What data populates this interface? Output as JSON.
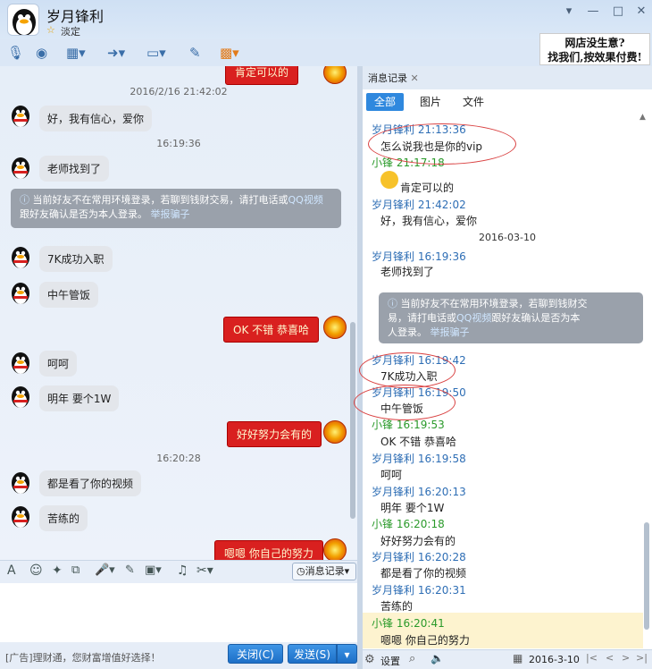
{
  "header": {
    "name": "岁月锋利",
    "status": "淡定"
  },
  "ad": {
    "line1": "网店没生意?",
    "line2": "找我们,按效果付费!"
  },
  "chat": {
    "items": {
      "red_top": "肯定可以的",
      "ts1": "2016/2/16 21:42:02",
      "m1": "好，我有信心，爱你",
      "ts2": "16:19:36",
      "m2": "老师找到了",
      "notice_a": "当前好友不在常用环境登录，若聊到钱财交易，请打电话或",
      "notice_link1": "QQ视频",
      "notice_b": "跟好友确认是否为本人登录。",
      "notice_link2": "举报骗子",
      "m3": "7K成功入职",
      "m4": "中午管饭",
      "r1": "OK 不错 恭喜哈",
      "m5": "呵呵",
      "m6": "明年 要个1W",
      "r2": "好好努力会有的",
      "ts3": "16:20:28",
      "m7": "都是看了你的视频",
      "m8": "苦练的",
      "r3": "嗯嗯 你自己的努力"
    }
  },
  "input": {
    "history_label": "消息记录"
  },
  "bottom": {
    "ad_text": "[广告]理财通，您财富增值好选择！",
    "close": "关闭(C)",
    "send": "发送(S)"
  },
  "history": {
    "tab": "消息记录",
    "filters": [
      "全部",
      "图片",
      "文件"
    ],
    "entries": [
      {
        "n": "岁月锋利 21:13:36",
        "m": "怎么说我也是你的vip",
        "c": "r"
      },
      {
        "n": "小锋 21:17:18",
        "m": "肯定可以的",
        "c": "g"
      },
      {
        "n": "岁月锋利 21:42:02",
        "m": "好，我有信心，爱你",
        "c": "r"
      },
      {
        "n": "岁月锋利 16:19:36",
        "m": "老师找到了",
        "c": "r"
      },
      {
        "n": "岁月锋利 16:19:42",
        "m": "7K成功入职",
        "c": "r"
      },
      {
        "n": "岁月锋利 16:19:50",
        "m": "中午管饭",
        "c": "r"
      },
      {
        "n": "小锋 16:19:53",
        "m": "OK 不错 恭喜哈",
        "c": "g"
      },
      {
        "n": "岁月锋利 16:19:58",
        "m": "呵呵",
        "c": "r"
      },
      {
        "n": "岁月锋利 16:20:13",
        "m": "明年 要个1W",
        "c": "r"
      },
      {
        "n": "小锋 16:20:18",
        "m": "好好努力会有的",
        "c": "g"
      },
      {
        "n": "岁月锋利 16:20:28",
        "m": "都是看了你的视频",
        "c": "r"
      },
      {
        "n": "岁月锋利 16:20:31",
        "m": "苦练的",
        "c": "r"
      },
      {
        "n": "小锋 16:20:41",
        "m": "嗯嗯 你自己的努力",
        "c": "g"
      }
    ],
    "date_sep": "2016-03-10",
    "notice_a": "当前好友不在常用环境登录，若聊到钱财交",
    "notice_b": "易，请打电话或",
    "notice_link1": "QQ视频",
    "notice_c": "跟好友确认是否为本",
    "notice_d": "人登录。",
    "notice_link2": "举报骗子",
    "settings": "设置",
    "date": "2016-3-10"
  }
}
